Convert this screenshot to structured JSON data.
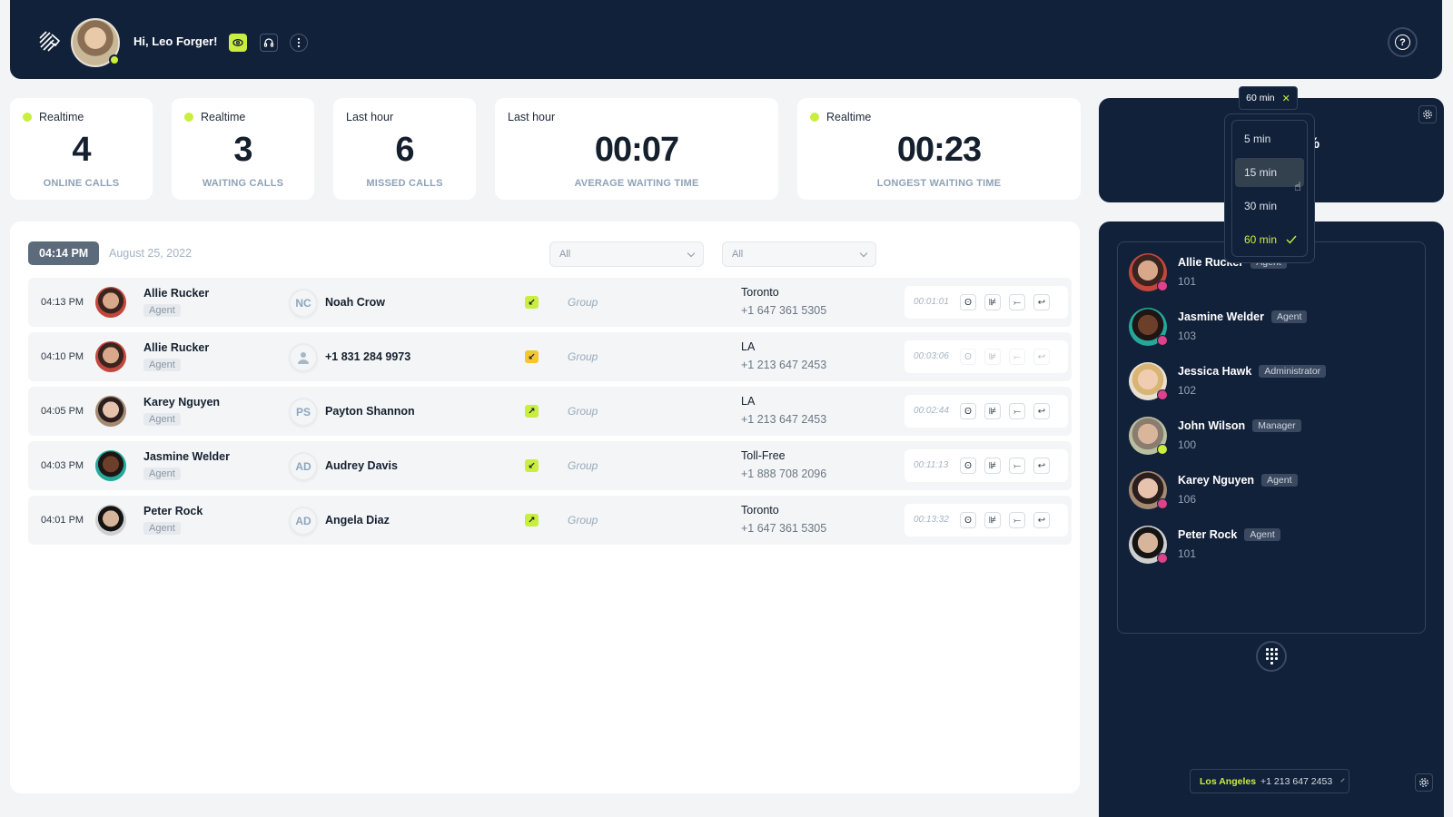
{
  "header": {
    "greeting": "Hi, Leo Forger!",
    "user_status": "online",
    "icons": [
      "logo-icon",
      "eye-icon",
      "headset-icon",
      "more-vertical-icon",
      "help-icon"
    ]
  },
  "stats": [
    {
      "label": "Realtime",
      "live": true,
      "value": "4",
      "caption": "ONLINE CALLS"
    },
    {
      "label": "Realtime",
      "live": true,
      "value": "3",
      "caption": "WAITING CALLS"
    },
    {
      "label": "Last hour",
      "live": false,
      "value": "6",
      "caption": "MISSED CALLS"
    },
    {
      "label": "Last hour",
      "live": false,
      "value": "00:07",
      "caption": "AVERAGE WAITING TIME"
    },
    {
      "label": "Realtime",
      "live": true,
      "value": "00:23",
      "caption": "LONGEST WAITING TIME"
    }
  ],
  "summary_card": {
    "percent_symbol": "%"
  },
  "time_dropdown": {
    "chip_label": "60 min",
    "options": [
      {
        "label": "5 min",
        "selected": false
      },
      {
        "label": "15 min",
        "selected": false,
        "hovered": true
      },
      {
        "label": "30 min",
        "selected": false
      },
      {
        "label": "60 min",
        "selected": true
      }
    ]
  },
  "calls": {
    "current_time": "04:14 PM",
    "date": "August 25, 2022",
    "filters": [
      "All",
      "All"
    ],
    "rows": [
      {
        "time": "04:13 PM",
        "agent": "Allie Rucker",
        "role": "Agent",
        "caller_initials": "NC",
        "caller": "Noah Crow",
        "direction": "incoming",
        "dir_color": "#c9ee3d",
        "group": "Group",
        "city": "Toronto",
        "number": "+1 647 361 5305",
        "duration": "00:01:01",
        "actions_enabled": true
      },
      {
        "time": "04:10 PM",
        "agent": "Allie Rucker",
        "role": "Agent",
        "caller_initials": "",
        "caller": "+1 831 284 9973",
        "direction": "incoming",
        "dir_color": "#f5c631",
        "group": "Group",
        "city": "LA",
        "number": "+1 213 647 2453",
        "duration": "00:03:06",
        "actions_enabled": false
      },
      {
        "time": "04:05 PM",
        "agent": "Karey Nguyen",
        "role": "Agent",
        "caller_initials": "PS",
        "caller": "Payton Shannon",
        "direction": "outgoing",
        "dir_color": "#c9ee3d",
        "group": "Group",
        "city": "LA",
        "number": "+1 213 647 2453",
        "duration": "00:02:44",
        "actions_enabled": true
      },
      {
        "time": "04:03 PM",
        "agent": "Jasmine Welder",
        "role": "Agent",
        "caller_initials": "AD",
        "caller": "Audrey Davis",
        "direction": "incoming",
        "dir_color": "#c9ee3d",
        "group": "Group",
        "city": "Toll-Free",
        "number": "+1 888 708 2096",
        "duration": "00:11:13",
        "actions_enabled": true
      },
      {
        "time": "04:01 PM",
        "agent": "Peter Rock",
        "role": "Agent",
        "caller_initials": "AD",
        "caller": "Angela Diaz",
        "direction": "outgoing",
        "dir_color": "#c9ee3d",
        "group": "Group",
        "city": "Toronto",
        "number": "+1 647 361 5305",
        "duration": "00:13:32",
        "actions_enabled": true
      }
    ],
    "action_icons": [
      "listen-icon",
      "whisper-icon",
      "barge-icon",
      "transfer-icon"
    ]
  },
  "agents": [
    {
      "name": "Allie Rucker",
      "role": "Agent",
      "ext": "101",
      "status": "on-call"
    },
    {
      "name": "Jasmine Welder",
      "role": "Agent",
      "ext": "103",
      "status": "on-call"
    },
    {
      "name": "Jessica Hawk",
      "role": "Administrator",
      "ext": "102",
      "status": "busy"
    },
    {
      "name": "John Wilson",
      "role": "Manager",
      "ext": "100",
      "status": "online"
    },
    {
      "name": "Karey Nguyen",
      "role": "Agent",
      "ext": "106",
      "status": "on-call"
    },
    {
      "name": "Peter Rock",
      "role": "Agent",
      "ext": "101",
      "status": "on-call"
    }
  ],
  "line_selector": {
    "city": "Los Angeles",
    "number": "+1 213 647 2453"
  },
  "colors": {
    "navy": "#12213a",
    "accent": "#c9ee3d",
    "busy": "#e0428a",
    "missed": "#f5c631"
  }
}
